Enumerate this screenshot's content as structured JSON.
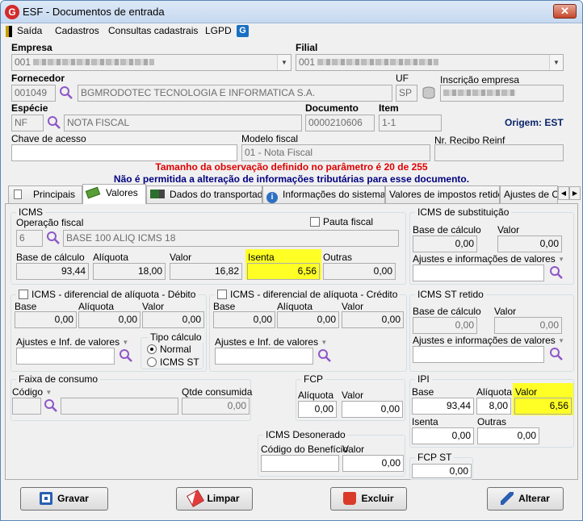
{
  "window": {
    "title": "ESF - Documentos de entrada",
    "close_glyph": "✕",
    "app_icon": "G"
  },
  "menu": {
    "items": [
      "Saída",
      "Cadastros",
      "Consultas cadastrais",
      "LGPD"
    ],
    "icon_glyph": "G"
  },
  "header": {
    "empresa_label": "Empresa",
    "empresa_code": "001",
    "filial_label": "Filial",
    "filial_code": "001",
    "fornecedor_label": "Fornecedor",
    "fornecedor_code": "001049",
    "fornecedor_name": "BGMRODOTEC TECNOLOGIA E INFORMATICA S.A.",
    "uf_label": "UF",
    "uf_value": "SP",
    "inscricao_label": "Inscrição empresa",
    "especie_label": "Espécie",
    "especie_code": "NF",
    "especie_name": "NOTA FISCAL",
    "documento_label": "Documento",
    "documento_value": "0000210606",
    "item_label": "Item",
    "item_value": "1-1",
    "origem_text": "Origem: EST",
    "chave_label": "Chave de acesso",
    "chave_value": "",
    "modelo_label": "Modelo fiscal",
    "modelo_value": "01 - Nota Fiscal",
    "recibo_label": "Nr. Recibo Reinf",
    "recibo_value": ""
  },
  "messages": {
    "obs_warning": "Tamanho da observação definido no parâmetro é 20 de 255",
    "tributaria_warning": "Não é permitida a alteração de informações tributárias para esse documento."
  },
  "tabs": [
    "Principais",
    "Valores",
    "Dados do transportador",
    "Informações do sistema",
    "Valores de impostos retidos",
    "Ajustes de C"
  ],
  "tab_scroll": {
    "left": "◀",
    "right": "▶"
  },
  "icms": {
    "group_title": "ICMS",
    "operacao_label": "Operação fiscal",
    "operacao_code": "6",
    "operacao_desc": "BASE 100 ALIQ ICMS 18",
    "pauta_label": "Pauta fiscal",
    "base_label": "Base de cálculo",
    "base_value": "93,44",
    "aliquota_label": "Alíquota",
    "aliquota_value": "18,00",
    "valor_label": "Valor",
    "valor_value": "16,82",
    "isenta_label": "Isenta",
    "isenta_value": "6,56",
    "outras_label": "Outras",
    "outras_value": "0,00"
  },
  "icms_sub": {
    "group_title": "ICMS de substituição",
    "base_label": "Base de cálculo",
    "base_value": "0,00",
    "valor_label": "Valor",
    "valor_value": "0,00",
    "ajustes_label": "Ajustes e informações de valores",
    "ajustes_value": ""
  },
  "difal_debito": {
    "group_title": "ICMS - diferencial de alíquota - Débito",
    "base_label": "Base",
    "base_value": "0,00",
    "aliq_label": "Alíquota",
    "aliq_value": "0,00",
    "valor_label": "Valor",
    "valor_value": "0,00",
    "ajustes_label": "Ajustes e Inf. de valores",
    "ajustes_value": "",
    "tipo_label": "Tipo cálculo",
    "normal_label": "Normal",
    "icmsst_label": "ICMS ST"
  },
  "difal_credito": {
    "group_title": "ICMS - diferencial de alíquota - Crédito",
    "base_label": "Base",
    "base_value": "0,00",
    "aliq_label": "Alíquota",
    "aliq_value": "0,00",
    "valor_label": "Valor",
    "valor_value": "0,00",
    "ajustes_label": "Ajustes e Inf. de valores",
    "ajustes_value": ""
  },
  "icms_st_retido": {
    "group_title": "ICMS ST retido",
    "base_label": "Base de cálculo",
    "base_value": "0,00",
    "valor_label": "Valor",
    "valor_value": "0,00",
    "ajustes_label": "Ajustes e informações de valores",
    "ajustes_value": ""
  },
  "faixa": {
    "group_title": "Faixa de consumo",
    "codigo_label": "Código",
    "codigo_value": "",
    "desc_value": "",
    "qtde_label": "Qtde consumida",
    "qtde_value": "0,00"
  },
  "fcp": {
    "group_title": "FCP",
    "aliq_label": "Alíquota",
    "aliq_value": "0,00",
    "valor_label": "Valor",
    "valor_value": "0,00"
  },
  "ipi": {
    "group_title": "IPI",
    "base_label": "Base",
    "base_value": "93,44",
    "aliq_label": "Alíquota",
    "aliq_value": "8,00",
    "valor_label": "Valor",
    "valor_value": "6,56",
    "isenta_label": "Isenta",
    "isenta_value": "0,00",
    "outras_label": "Outras",
    "outras_value": "0,00"
  },
  "desonerado": {
    "group_title": "ICMS Desonerado",
    "codigo_label": "Código do Benefício",
    "codigo_value": "",
    "valor_label": "Valor",
    "valor_value": "0,00"
  },
  "fcp_st": {
    "group_title": "FCP ST",
    "valor_value": "0,00"
  },
  "buttons": {
    "gravar": "Gravar",
    "limpar": "Limpar",
    "excluir": "Excluir",
    "alterar": "Alterar"
  },
  "colors": {
    "highlight": "#ffff26",
    "warning_red": "#e00000",
    "info_navy": "#000080",
    "close_red": "#c4472b"
  }
}
